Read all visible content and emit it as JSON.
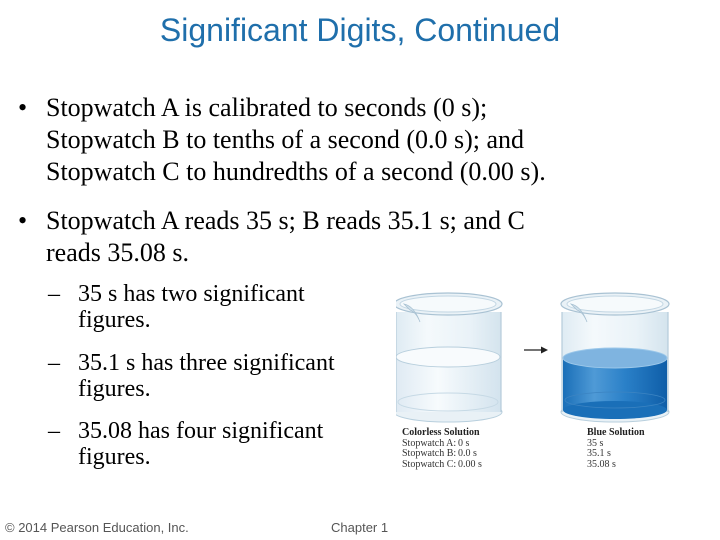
{
  "slide": {
    "title": "Significant Digits, Continued",
    "bullets": [
      {
        "marker": "•",
        "lines": [
          "Stopwatch A is calibrated to seconds (0 s);",
          "Stopwatch B to tenths of a second (0.0 s); and",
          "Stopwatch C to hundredths of a second (0.00 s)."
        ]
      },
      {
        "marker": "•",
        "lines": [
          "Stopwatch A reads 35 s; B reads 35.1 s; and C",
          "reads 35.08 s."
        ]
      }
    ],
    "sub_bullets": [
      {
        "marker": "–",
        "lines": [
          "35 s has two significant",
          "figures."
        ]
      },
      {
        "marker": "–",
        "lines": [
          "35.1 s has three significant",
          "figures."
        ]
      },
      {
        "marker": "–",
        "lines": [
          "35.08 has four significant",
          "figures."
        ]
      }
    ],
    "figure": {
      "left_beaker": "colorless-solution-beaker",
      "right_beaker": "blue-solution-beaker",
      "arrow": "right-arrow",
      "liquid_color": "#1a7ac4",
      "legend": {
        "colorless": {
          "header": "Colorless Solution",
          "rows": [
            {
              "label": "Stopwatch A:",
              "value": "0 s"
            },
            {
              "label": "Stopwatch B:",
              "value": "0.0 s"
            },
            {
              "label": "Stopwatch C:",
              "value": "0.00 s"
            }
          ]
        },
        "blue": {
          "header": "Blue Solution",
          "rows": [
            {
              "value": "35 s"
            },
            {
              "value": "35.1 s"
            },
            {
              "value": "35.08 s"
            }
          ]
        }
      }
    },
    "footer": {
      "copyright": "© 2014 Pearson Education, Inc.",
      "chapter": "Chapter 1"
    }
  },
  "colors": {
    "title": "#1f6fab",
    "body_text": "#000000",
    "footer_text": "#555555"
  }
}
